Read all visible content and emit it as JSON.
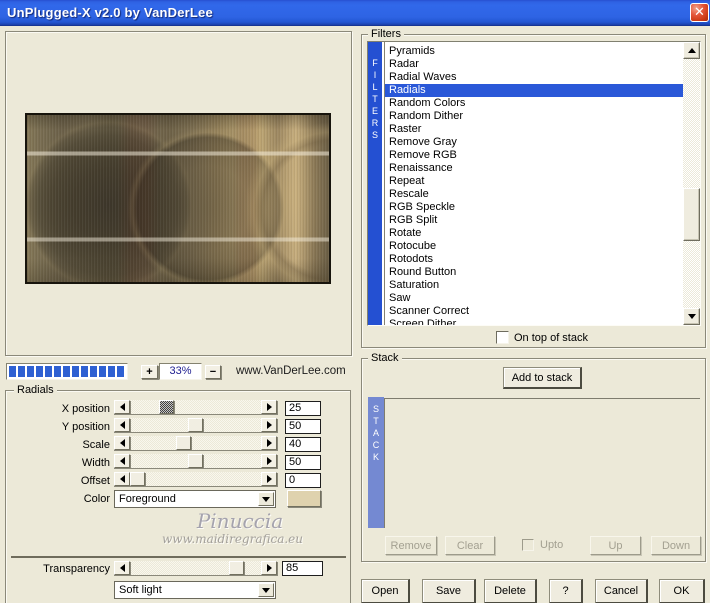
{
  "window": {
    "title": "UnPlugged-X v2.0 by VanDerLee",
    "close_glyph": "✕"
  },
  "preview": {
    "progress_segments": 13,
    "zoom_in_label": "+",
    "zoom_out_label": "−",
    "zoom_value": "33%",
    "website": "www.VanDerLee.com"
  },
  "filters": {
    "group_label": "Filters",
    "side_label": "FILTERS",
    "items": [
      "Pyramids",
      "Radar",
      "Radial Waves",
      "Radials",
      "Random Colors",
      "Random Dither",
      "Raster",
      "Remove Gray",
      "Remove RGB",
      "Renaissance",
      "Repeat",
      "Rescale",
      "RGB Speckle",
      "RGB Split",
      "Rotate",
      "Rotocube",
      "Rotodots",
      "Round Button",
      "Saturation",
      "Saw",
      "Scanner Correct",
      "Screen Dither"
    ],
    "selected_item": "Radials",
    "on_top_label": "On top of stack",
    "on_top_checked": false
  },
  "radials": {
    "group_label": "Radials",
    "sliders": [
      {
        "label": "X position",
        "value": 25,
        "hatched": true
      },
      {
        "label": "Y position",
        "value": 50,
        "hatched": false
      },
      {
        "label": "Scale",
        "value": 40,
        "hatched": false
      },
      {
        "label": "Width",
        "value": 50,
        "hatched": false
      },
      {
        "label": "Offset",
        "value": 0,
        "hatched": false
      }
    ],
    "color_label": "Color",
    "color_value": "Foreground",
    "color_swatch_hex": "#DFD2AE",
    "transparency_label": "Transparency",
    "transparency_value": 85,
    "blend_mode": "Soft light"
  },
  "watermark": {
    "name": "Pinuccia",
    "site": "www.maidiregrafica.eu"
  },
  "stack": {
    "group_label": "Stack",
    "side_label": "STACK",
    "add_button": "Add to stack",
    "remove_button": "Remove",
    "clear_button": "Clear",
    "upto_label": "Upto",
    "upto_checked": false,
    "up_button": "Up",
    "down_button": "Down"
  },
  "footer": {
    "buttons": [
      "Open",
      "Save",
      "Delete",
      "?",
      "Cancel",
      "OK"
    ]
  },
  "colors": {
    "dialog_bg": "#ECE9D8",
    "titlebar_blue": "#2E64E4",
    "selection_blue": "#2A58D8",
    "filters_bar_blue": "#2450D2",
    "stack_bar_blue": "#7489D2",
    "progress_blue": "#2E60D2",
    "close_red": "#CC3913"
  }
}
